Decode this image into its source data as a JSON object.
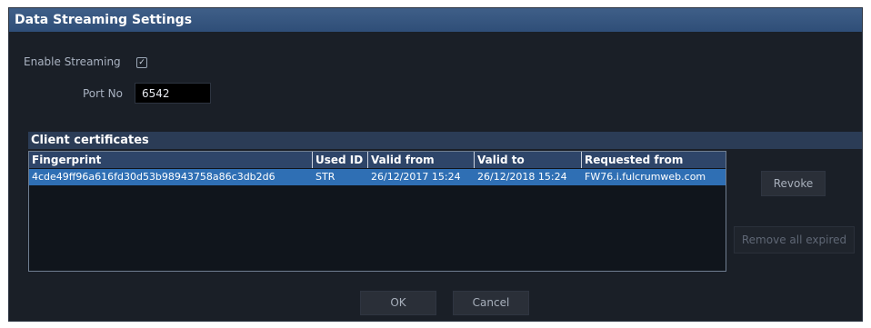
{
  "window": {
    "title": "Data Streaming Settings"
  },
  "streaming": {
    "enable_label": "Enable Streaming",
    "enable_checked": "✓",
    "port_label": "Port No",
    "port_value": "6542"
  },
  "certificates": {
    "section_title": "Client certificates",
    "columns": [
      "Fingerprint",
      "Used ID",
      "Valid from",
      "Valid to",
      "Requested from"
    ],
    "rows": [
      {
        "fingerprint": "4cde49ff96a616fd30d53b98943758a86c3db2d6",
        "used_id": "STR",
        "valid_from": "26/12/2017 15:24",
        "valid_to": "26/12/2018 15:24",
        "requested_from": "FW76.i.fulcrumweb.com"
      }
    ]
  },
  "buttons": {
    "revoke": "Revoke",
    "remove_expired": "Remove all expired",
    "ok": "OK",
    "cancel": "Cancel"
  }
}
